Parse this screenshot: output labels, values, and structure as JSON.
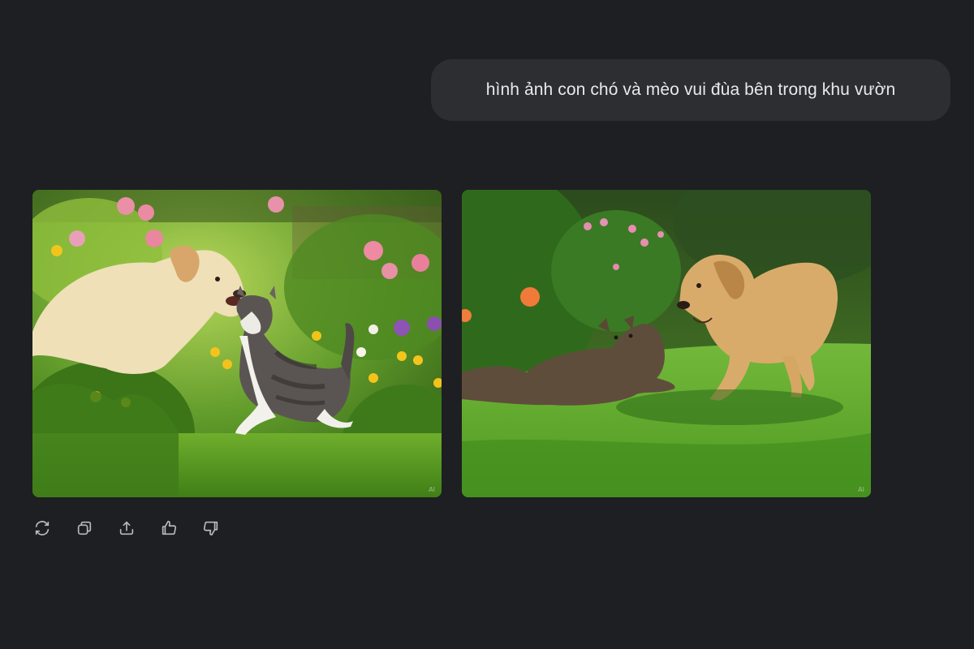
{
  "message": {
    "text": "hình ảnh con chó và mèo vui đùa bên trong khu vườn"
  },
  "images": [
    {
      "watermark": "AI"
    },
    {
      "watermark": "AI"
    }
  ],
  "actions": [
    {
      "icon": "regenerate-icon"
    },
    {
      "icon": "copy-icon"
    },
    {
      "icon": "share-icon"
    },
    {
      "icon": "thumbs-up-icon"
    },
    {
      "icon": "thumbs-down-icon"
    }
  ]
}
